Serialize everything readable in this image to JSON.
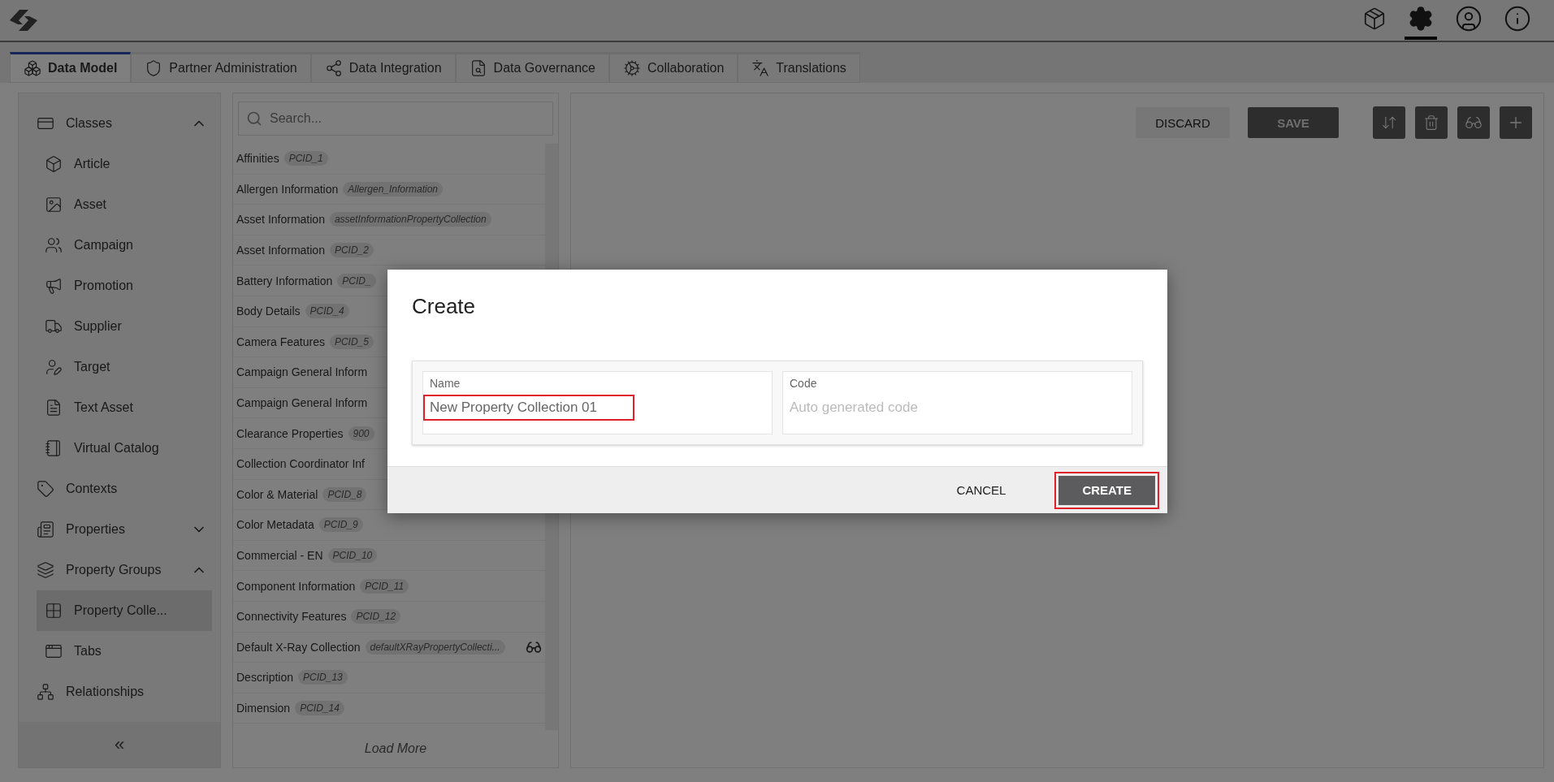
{
  "tabs": [
    {
      "label": "Data Model",
      "selected": true
    },
    {
      "label": "Partner Administration",
      "selected": false
    },
    {
      "label": "Data Integration",
      "selected": false
    },
    {
      "label": "Data Governance",
      "selected": false
    },
    {
      "label": "Collaboration",
      "selected": false
    },
    {
      "label": "Translations",
      "selected": false
    }
  ],
  "sidebar": {
    "items": [
      {
        "label": "Classes",
        "expanded": true,
        "children": [
          {
            "label": "Article",
            "selected": false
          },
          {
            "label": "Asset",
            "selected": false
          },
          {
            "label": "Campaign",
            "selected": false
          },
          {
            "label": "Promotion",
            "selected": false
          },
          {
            "label": "Supplier",
            "selected": false
          },
          {
            "label": "Target",
            "selected": false
          },
          {
            "label": "Text Asset",
            "selected": false
          },
          {
            "label": "Virtual Catalog",
            "selected": false
          }
        ]
      },
      {
        "label": "Contexts"
      },
      {
        "label": "Properties",
        "expanded": false
      },
      {
        "label": "Property Groups",
        "expanded": true,
        "children": [
          {
            "label": "Property Colle...",
            "selected": true
          },
          {
            "label": "Tabs",
            "selected": false
          }
        ]
      },
      {
        "label": "Relationships"
      }
    ],
    "collapse": "«"
  },
  "search": {
    "placeholder": "Search..."
  },
  "list": {
    "rows": [
      {
        "name": "Affinities",
        "code": "PCID_1"
      },
      {
        "name": "Allergen Information",
        "code": "Allergen_Information"
      },
      {
        "name": "Asset Information",
        "code": "assetInformationPropertyCollection"
      },
      {
        "name": "Asset Information",
        "code": "PCID_2"
      },
      {
        "name": "Battery Information",
        "code": "PCID_"
      },
      {
        "name": "Body Details",
        "code": "PCID_4"
      },
      {
        "name": "Camera Features",
        "code": "PCID_5"
      },
      {
        "name": "Campaign General Inform"
      },
      {
        "name": "Campaign General Inform"
      },
      {
        "name": "Clearance Properties",
        "code": "900"
      },
      {
        "name": "Collection Coordinator Inf"
      },
      {
        "name": "Color & Material",
        "code": "PCID_8"
      },
      {
        "name": "Color Metadata",
        "code": "PCID_9"
      },
      {
        "name": "Commercial - EN",
        "code": "PCID_10"
      },
      {
        "name": "Component Information",
        "code": "PCID_11"
      },
      {
        "name": "Connectivity Features",
        "code": "PCID_12"
      },
      {
        "name": "Default X-Ray Collection",
        "code": "defaultXRayPropertyCollecti...",
        "xray": true
      },
      {
        "name": "Description",
        "code": "PCID_13"
      },
      {
        "name": "Dimension",
        "code": "PCID_14"
      }
    ],
    "load_more": "Load More"
  },
  "toolbar": {
    "discard": "DISCARD",
    "save": "SAVE"
  },
  "dialog": {
    "title": "Create",
    "fields": [
      {
        "label": "Name",
        "value": "New Property Collection 01",
        "highlighted": true
      },
      {
        "label": "Code",
        "placeholder": "Auto generated code",
        "highlighted": false
      }
    ],
    "buttons": [
      {
        "label": "CANCEL",
        "kind": "text",
        "highlighted": false
      },
      {
        "label": "CREATE",
        "kind": "primary",
        "highlighted": true
      }
    ]
  }
}
